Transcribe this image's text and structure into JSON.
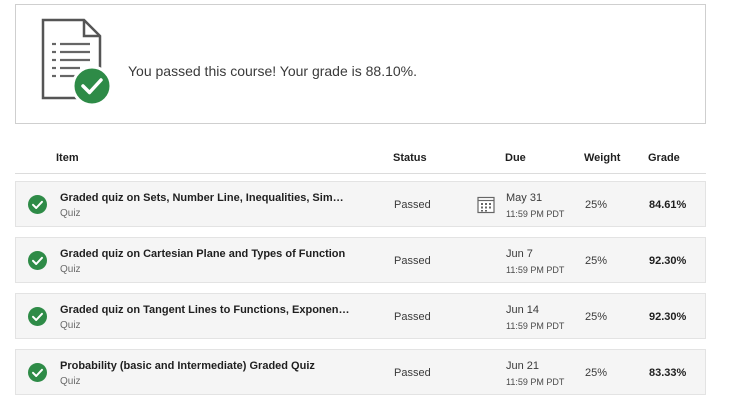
{
  "banner": {
    "message": "You passed this course! Your grade is 88.10%.",
    "icon": "document-check-icon"
  },
  "table": {
    "headers": {
      "item": "Item",
      "status": "Status",
      "due": "Due",
      "weight": "Weight",
      "grade": "Grade"
    },
    "rows": [
      {
        "title": "Graded quiz on Sets, Number Line, Inequalities, Sim…",
        "type": "Quiz",
        "status": "Passed",
        "due_date": "May 31",
        "due_time": "11:59 PM PDT",
        "weight": "25%",
        "grade": "84.61%"
      },
      {
        "title": "Graded quiz on Cartesian Plane and Types of Function",
        "type": "Quiz",
        "status": "Passed",
        "due_date": "Jun 7",
        "due_time": "11:59 PM PDT",
        "weight": "25%",
        "grade": "92.30%"
      },
      {
        "title": "Graded quiz on Tangent Lines to Functions, Exponen…",
        "type": "Quiz",
        "status": "Passed",
        "due_date": "Jun 14",
        "due_time": "11:59 PM PDT",
        "weight": "25%",
        "grade": "92.30%"
      },
      {
        "title": "Probability (basic and Intermediate) Graded Quiz",
        "type": "Quiz",
        "status": "Passed",
        "due_date": "Jun 21",
        "due_time": "11:59 PM PDT",
        "weight": "25%",
        "grade": "83.33%"
      }
    ]
  },
  "colors": {
    "success_green": "#2e8b47",
    "row_background": "#f5f5f5",
    "border": "#cfcfcf"
  }
}
